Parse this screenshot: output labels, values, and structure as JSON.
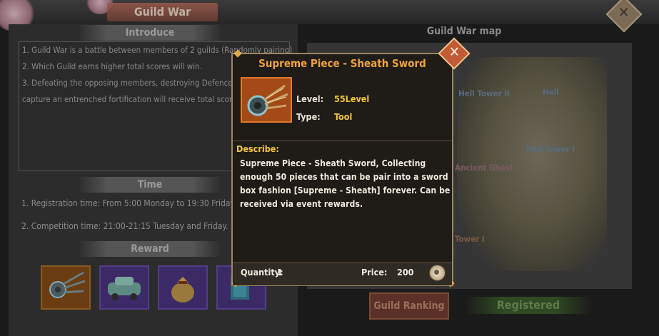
{
  "window": {
    "title": "Guild War"
  },
  "introduce": {
    "heading": "Introduce",
    "lines": [
      "1. Guild War is a battle between members of 2 guilds (Randomly pairing)",
      "2. Which Guild earns higher total scores will win.",
      "3. Defeating the opposing members, destroying Defence towers, d",
      "capture an entrenched fortification will receive total scores"
    ]
  },
  "time": {
    "heading": "Time",
    "registration": "1. Registration time: From 5:00 Monday to 19:30 Friday.",
    "competition": "2. Competition time: 21:00-21:15 Tuesday and Friday."
  },
  "reward": {
    "heading": "Reward",
    "slots": [
      {
        "rarity": "orange",
        "icon": "sheath-sword-icon"
      },
      {
        "rarity": "purple",
        "icon": "car-icon"
      },
      {
        "rarity": "purple",
        "icon": "money-bag-icon"
      },
      {
        "rarity": "purple",
        "icon": "book-icon"
      }
    ]
  },
  "map": {
    "title": "Guild War map",
    "labels": {
      "hell_tower_2": "Hell Tower II",
      "hell": "Hell",
      "hell_tower_1": "Hell Tower I",
      "ancient_ghost": "Ancient Ghost",
      "tower_1": "Tower I"
    }
  },
  "buttons": {
    "guild_ranking": "Guild Ranking",
    "registered": "Registered"
  },
  "popup": {
    "title": "Supreme Piece - Sheath Sword",
    "level_label": "Level:",
    "level_value": "55Level",
    "type_label": "Type:",
    "type_value": "Tool",
    "describe_label": "Describe:",
    "description": "Supreme Piece - Sheath Sword, Collecting enough 50 pieces that can be pair into a sword box fashion [Supreme - Sheath] forever. Can be received via event rewards.",
    "quantity_label": "Quantity:",
    "quantity_value": "1",
    "price_label": "Price:",
    "price_value": "200",
    "close_glyph": "✕",
    "currency_icon": "coin-icon"
  },
  "colors": {
    "popup_title": "#f0a23a",
    "value_yellow": "#f1c63a",
    "item_frame_orange": "#a44a16"
  }
}
